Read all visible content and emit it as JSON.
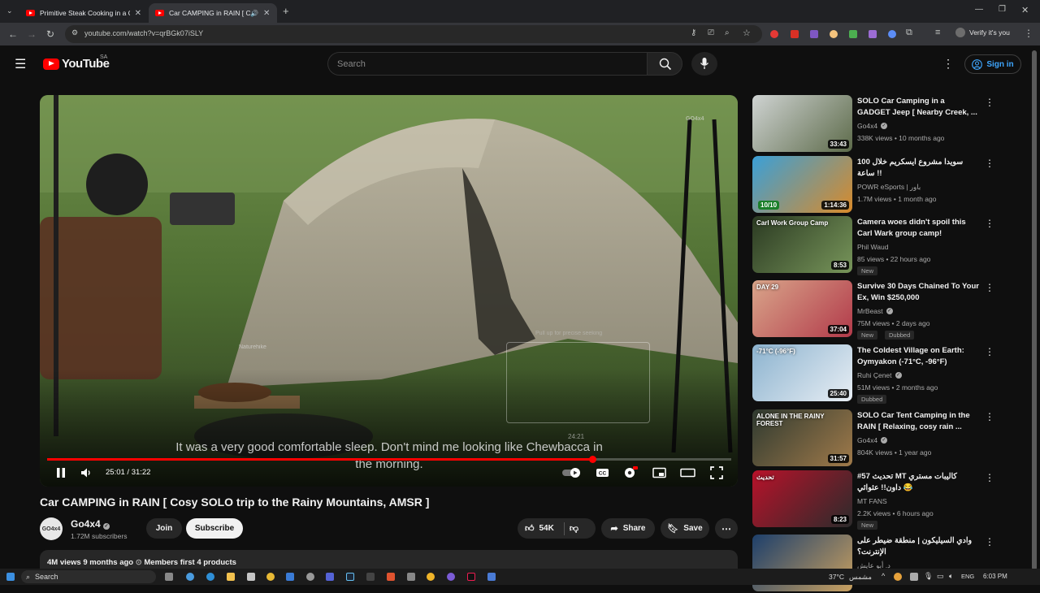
{
  "browser": {
    "tabs": [
      {
        "title": "Primitive Steak Cooking in a Cla"
      },
      {
        "title": "Car CAMPING in RAIN [ Cosy"
      }
    ],
    "url": "youtube.com/watch?v=qrBGk07iSLY",
    "profile_label": "Verify it's you"
  },
  "header": {
    "logo": "YouTube",
    "country_code": "SA",
    "search_placeholder": "Search",
    "sign_in_label": "Sign in"
  },
  "player": {
    "caption_line1": "It was a very good comfortable sleep. Don't mind me looking like Chewbacca in",
    "caption_line2": "the morning.",
    "current_time": "25:01",
    "duration": "31:22",
    "time_display": "25:01 / 31:22",
    "hover_time": "24:21",
    "seek_hint": "Pull up for precise seeking",
    "progress": 0.797,
    "hover_progress": 0.755,
    "brand_watermark": "GO4x4",
    "tent_brand": "Naturehike"
  },
  "video": {
    "title": "Car CAMPING in RAIN [ Cosy SOLO trip to the Rainy Mountains, AMSR ]",
    "channel": "Go4x4",
    "channel_avatar_text": "GO4x4",
    "subscribers": "1.72M subscribers",
    "join_label": "Join",
    "subscribe_label": "Subscribe",
    "likes": "54K",
    "share_label": "Share",
    "save_label": "Save",
    "views": "4M views",
    "uploaded": "9 months ago",
    "members_first": "Members first",
    "products": "4 products"
  },
  "recommendations": [
    {
      "title": "SOLO Car Camping in a GADGET Jeep [ Nearby Creek, ...",
      "channel": "Go4x4",
      "verified": true,
      "views": "338K views",
      "age": "10 months ago",
      "duration": "33:43",
      "tags": [],
      "thumb": [
        "#cfd3d2",
        "#5d6b4a"
      ]
    },
    {
      "title": "سويدا مشروع ايسكريم خلال 100 ساعة !!",
      "channel": "POWR eSports | باور",
      "verified": false,
      "views": "1.7M views",
      "age": "1 month ago",
      "duration": "1:14:36",
      "badge": "10/10",
      "tags": [],
      "thumb": [
        "#3aa0d8",
        "#d98a2a"
      ]
    },
    {
      "title": "Camera woes didn't spoil this Carl Wark group camp!",
      "channel": "Phil Waud",
      "verified": false,
      "views": "85 views",
      "age": "22 hours ago",
      "duration": "8:53",
      "thumb_text": "Carl Work Group Camp",
      "tags": [
        "New"
      ],
      "thumb": [
        "#2b3a22",
        "#77955a"
      ]
    },
    {
      "title": "Survive 30 Days Chained To Your Ex, Win $250,000",
      "channel": "MrBeast",
      "verified": true,
      "views": "75M views",
      "age": "2 days ago",
      "duration": "37:04",
      "thumb_text": "DAY 29",
      "tags": [
        "New",
        "Dubbed"
      ],
      "thumb": [
        "#d9a58a",
        "#b23a4a"
      ]
    },
    {
      "title": "The Coldest Village on Earth: Oymyakon (-71°C, -96°F)",
      "channel": "Ruhi Çenet",
      "verified": true,
      "views": "51M views",
      "age": "2 months ago",
      "duration": "25:40",
      "thumb_text": "-71°C (-96°F)",
      "tags": [
        "Dubbed"
      ],
      "thumb": [
        "#8cb3cf",
        "#e8eef4"
      ]
    },
    {
      "title": "SOLO Car Tent Camping in the RAIN [ Relaxing, cosy rain ...",
      "channel": "Go4x4",
      "verified": true,
      "views": "804K views",
      "age": "1 year ago",
      "duration": "31:57",
      "thumb_text": "ALONE IN THE RAINY FOREST",
      "tags": [],
      "thumb": [
        "#2f3a30",
        "#a07a4a"
      ]
    },
    {
      "title": "#57 تحديث MT كاليبات مستري داون!! عثوائي 😂",
      "channel": "MT FANS",
      "verified": false,
      "views": "2.2K views",
      "age": "6 hours ago",
      "duration": "8:23",
      "thumb_text": "تحديث",
      "tags": [
        "New"
      ],
      "thumb": [
        "#b8122a",
        "#2b2b2b"
      ]
    },
    {
      "title": "وادي السيليكون | منطقة ضيطر على الإنترنت؟",
      "channel": "د. أبو عايش",
      "verified": false,
      "views": "",
      "age": "",
      "duration": "",
      "tags": [],
      "thumb": [
        "#1d3f6b",
        "#c8a060"
      ]
    }
  ],
  "taskbar": {
    "search_label": "Search",
    "temperature": "37°C",
    "weather": "مشمس",
    "language": "ENG",
    "time": "6:03 PM"
  },
  "colors": {
    "accent": "#ff0000",
    "link": "#3ea6ff",
    "background": "#0f0f0f",
    "surface": "#272727"
  }
}
